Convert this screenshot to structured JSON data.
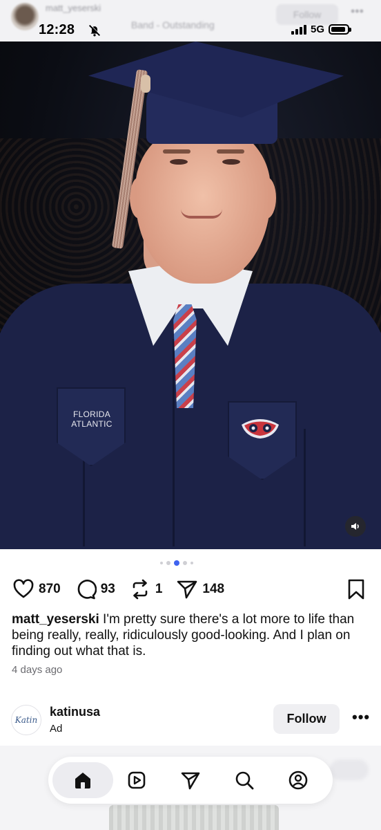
{
  "status_bar": {
    "time": "12:28",
    "network": "5G",
    "silent_mode": true
  },
  "header_overlay": {
    "username": "matt_yeserski",
    "song": "Band - Outstanding",
    "follow_label": "Follow"
  },
  "photo": {
    "pocket_text_line1": "FLORIDA",
    "pocket_text_line2": "ATLANTIC",
    "sound_icon": "speaker-icon"
  },
  "carousel": {
    "total_dots": 5,
    "active_index": 2
  },
  "actions": {
    "likes": "870",
    "comments": "93",
    "reposts": "1",
    "shares": "148"
  },
  "caption": {
    "username": "matt_yeserski",
    "text": "I'm pretty sure there's a lot more to life than being really, really, ridiculously good-looking. And I plan on finding out what that is."
  },
  "time_ago": "4 days ago",
  "ad": {
    "logo_text": "Katin",
    "name": "katinusa",
    "label": "Ad",
    "follow_label": "Follow",
    "more_label": "•••"
  },
  "nav": {
    "items": [
      "home-icon",
      "reels-icon",
      "send-icon",
      "search-icon",
      "profile-icon"
    ],
    "active": "home"
  },
  "colors": {
    "accent_dot": "#3f63ef",
    "follow_button_bg": "#efeff2"
  }
}
